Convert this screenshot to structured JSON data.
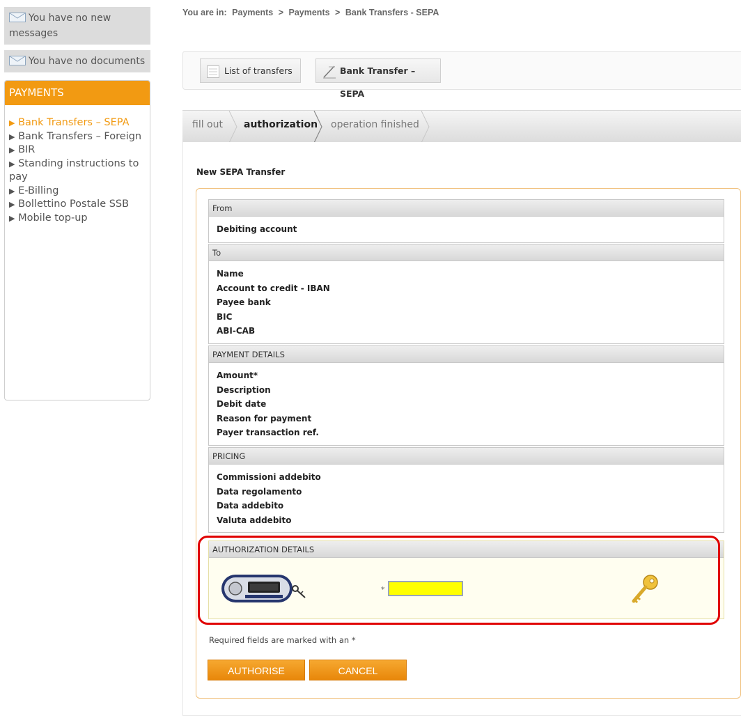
{
  "sidebar": {
    "messages_text": "You have no new messages",
    "documents_text": "You have no documents",
    "payments_header": "PAYMENTS",
    "items": [
      {
        "label": "Bank Transfers – SEPA",
        "active": true
      },
      {
        "label": "Bank Transfers – Foreign",
        "active": false
      },
      {
        "label": "BIR",
        "active": false
      },
      {
        "label": "Standing instructions to pay",
        "active": false
      },
      {
        "label": "E-Billing",
        "active": false
      },
      {
        "label": "Bollettino Postale SSB",
        "active": false
      },
      {
        "label": "Mobile top-up",
        "active": false
      }
    ]
  },
  "breadcrumb": {
    "prefix": "You are in:",
    "parts": [
      "Payments",
      "Payments",
      "Bank Transfers - SEPA"
    ],
    "separator": ">"
  },
  "toolbar": {
    "list_label": "List of transfers",
    "sepa_label": "Bank Transfer – SEPA"
  },
  "steps": [
    {
      "label": "fill out",
      "active": false
    },
    {
      "label": "authorization",
      "active": true
    },
    {
      "label": "operation finished",
      "active": false
    }
  ],
  "form": {
    "title": "New SEPA Transfer",
    "sections": {
      "from": {
        "header": "From",
        "fields": [
          "Debiting account"
        ]
      },
      "to": {
        "header": "To",
        "fields": [
          "Name",
          "Account to credit - IBAN",
          "Payee bank",
          "BIC",
          "ABI-CAB"
        ]
      },
      "payment": {
        "header": "PAYMENT DETAILS",
        "fields": [
          "Amount*",
          "Description",
          "Debit date",
          "Reason for payment",
          "Payer transaction ref."
        ]
      },
      "pricing": {
        "header": "PRICING",
        "fields": [
          "Commissioni addebito",
          "Data regolamento",
          "Data addebito",
          "Valuta addebito"
        ]
      }
    },
    "authorization": {
      "header": "AUTHORIZATION DETAILS",
      "required_marker": "*",
      "otp_value": ""
    },
    "required_note": "Required fields are marked with an *",
    "authorise_label": "AUTHORISE",
    "cancel_label": "CANCEL"
  },
  "colors": {
    "accent": "#f29a12",
    "highlight_input": "#ffff00",
    "callout": "#e00000"
  },
  "icons": {
    "messages": "envelope-icon",
    "documents": "envelope-icon",
    "list": "list-icon",
    "sepa": "pen-icon",
    "token": "otp-token-icon",
    "key": "key-icon"
  }
}
